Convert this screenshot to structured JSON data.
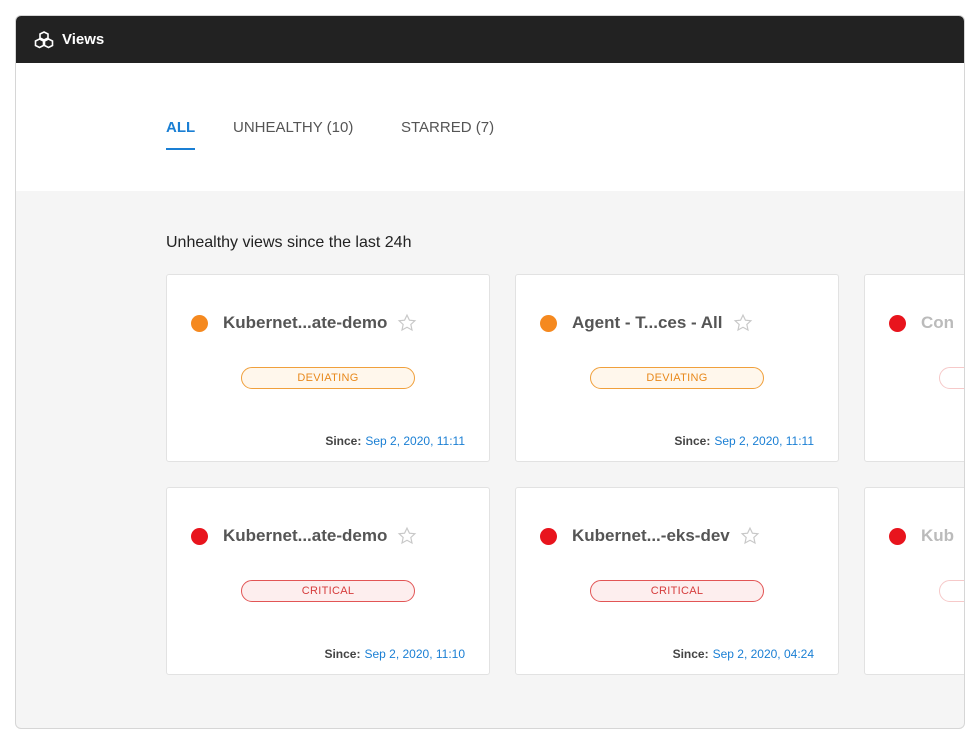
{
  "window": {
    "title": "Views",
    "icon": "cubes-icon"
  },
  "tabs": [
    {
      "label": "ALL",
      "active": true
    },
    {
      "label": "UNHEALTHY (10)",
      "active": false
    },
    {
      "label": "STARRED (7)",
      "active": false
    }
  ],
  "section_title": "Unhealthy views since the last 24h",
  "since_label": "Since:",
  "colors": {
    "deviating": "#f5891f",
    "critical": "#e8141d",
    "link": "#1a7fd4",
    "titlebar": "#222222"
  },
  "cards": [
    {
      "name": "Kubernet...ate-demo",
      "status": "DEVIATING",
      "since": "Sep 2, 2020, 11:11",
      "dot": "#f5891f"
    },
    {
      "name": "Agent - T...ces - All",
      "status": "DEVIATING",
      "since": "Sep 2, 2020, 11:11",
      "dot": "#f5891f"
    },
    {
      "name": "Con",
      "dot": "#e8141d"
    },
    {
      "name": "Kubernet...ate-demo",
      "status": "CRITICAL",
      "since": "Sep 2, 2020, 11:10",
      "dot": "#e8141d"
    },
    {
      "name": "Kubernet...-eks-dev",
      "status": "CRITICAL",
      "since": "Sep 2, 2020, 04:24",
      "dot": "#e8141d"
    },
    {
      "name": "Kub",
      "dot": "#e8141d"
    }
  ]
}
